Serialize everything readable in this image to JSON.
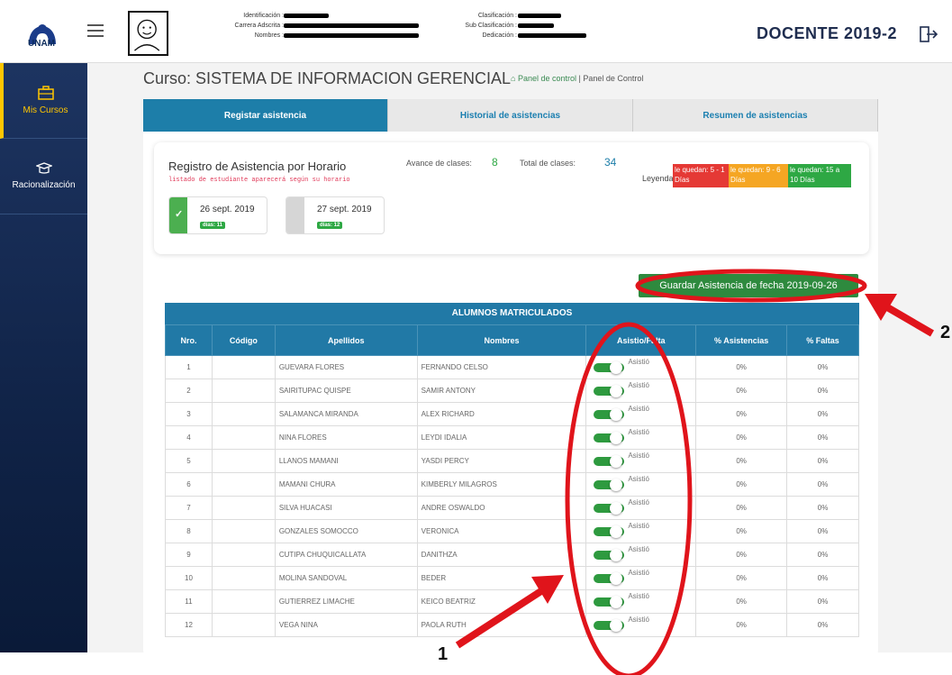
{
  "header": {
    "logo_text": "UNAM",
    "info_left": [
      "Identificación :",
      "Carrera Adscrita :",
      "Nombres :"
    ],
    "info_right": [
      "Clasificación :",
      "Sub Clasificación :",
      "Dedicación :"
    ],
    "role": "DOCENTE 2019-2"
  },
  "sidebar": {
    "items": [
      {
        "label": "Mis Cursos",
        "icon": "briefcase-icon"
      },
      {
        "label": "Racionalización",
        "icon": "graduation-cap-icon"
      }
    ]
  },
  "course": {
    "title": "Curso: SISTEMA DE INFORMACION GERENCIAL",
    "crumb_link": "Panel de control",
    "crumb_current": "Panel de Control"
  },
  "tabs": [
    "Registar asistencia",
    "Historial de asistencias",
    "Resumen de asistencias"
  ],
  "registro": {
    "title": "Registro de Asistencia por Horario",
    "subtitle": "listado de estudiante aparecerá según su horario",
    "avance_label": "Avance de clases:",
    "avance_value": "8",
    "total_label": "Total de clases:",
    "total_value": "34",
    "leyenda_label": "Leyenda:",
    "leyenda": [
      {
        "text": "le quedan: 5 - 1 Días",
        "color": "#e53935"
      },
      {
        "text": "le quedan: 9 - 6 Días",
        "color": "#f5a623"
      },
      {
        "text": "le quedan: 15 a 10 Días",
        "color": "#2ea844"
      }
    ],
    "dates": [
      {
        "date": "26 sept. 2019",
        "badge": "días: 11",
        "color": "#4caf50"
      },
      {
        "date": "27 sept. 2019",
        "badge": "días: 12",
        "color": "#d6d6d6"
      }
    ]
  },
  "save_button": "Guardar Asistencia de fecha 2019-09-26",
  "table": {
    "caption": "ALUMNOS MATRICULADOS",
    "headers": [
      "Nro.",
      "Código",
      "Apellidos",
      "Nombres",
      "Asistio/Falta",
      "% Asistencias",
      "% Faltas"
    ],
    "status_label": "Asistió",
    "rows": [
      {
        "nro": "1",
        "codigo": "",
        "apellidos": "GUEVARA FLORES",
        "nombres": "FERNANDO CELSO",
        "asis": "0%",
        "faltas": "0%"
      },
      {
        "nro": "2",
        "codigo": "",
        "apellidos": "SAIRITUPAC QUISPE",
        "nombres": "SAMIR ANTONY",
        "asis": "0%",
        "faltas": "0%"
      },
      {
        "nro": "3",
        "codigo": "",
        "apellidos": "SALAMANCA MIRANDA",
        "nombres": "ALEX RICHARD",
        "asis": "0%",
        "faltas": "0%"
      },
      {
        "nro": "4",
        "codigo": "",
        "apellidos": "NINA FLORES",
        "nombres": "LEYDI IDALIA",
        "asis": "0%",
        "faltas": "0%"
      },
      {
        "nro": "5",
        "codigo": "",
        "apellidos": "LLANOS MAMANI",
        "nombres": "YASDI PERCY",
        "asis": "0%",
        "faltas": "0%"
      },
      {
        "nro": "6",
        "codigo": "",
        "apellidos": "MAMANI CHURA",
        "nombres": "KIMBERLY MILAGROS",
        "asis": "0%",
        "faltas": "0%"
      },
      {
        "nro": "7",
        "codigo": "",
        "apellidos": "SILVA HUACASI",
        "nombres": "ANDRE OSWALDO",
        "asis": "0%",
        "faltas": "0%"
      },
      {
        "nro": "8",
        "codigo": "",
        "apellidos": "GONZALES SOMOCCO",
        "nombres": "VERONICA",
        "asis": "0%",
        "faltas": "0%"
      },
      {
        "nro": "9",
        "codigo": "",
        "apellidos": "CUTIPA CHUQUICALLATA",
        "nombres": "DANITHZA",
        "asis": "0%",
        "faltas": "0%"
      },
      {
        "nro": "10",
        "codigo": "",
        "apellidos": "MOLINA SANDOVAL",
        "nombres": "BEDER",
        "asis": "0%",
        "faltas": "0%"
      },
      {
        "nro": "11",
        "codigo": "",
        "apellidos": "GUTIERREZ LIMACHE",
        "nombres": "KEICO BEATRIZ",
        "asis": "0%",
        "faltas": "0%"
      },
      {
        "nro": "12",
        "codigo": "",
        "apellidos": "VEGA NINA",
        "nombres": "PAOLA RUTH",
        "asis": "0%",
        "faltas": "0%"
      }
    ]
  },
  "annotations": {
    "label_1": "1",
    "label_2": "2",
    "color": "#e0141b"
  }
}
